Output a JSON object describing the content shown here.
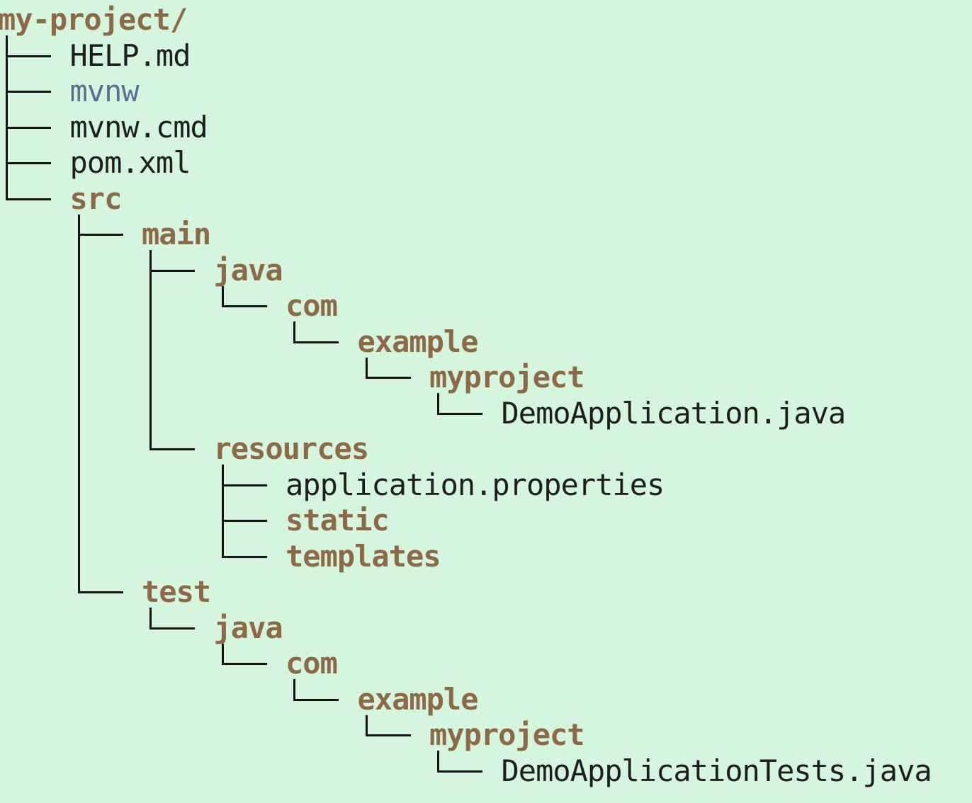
{
  "tree": {
    "root": "my-project/",
    "nodes": [
      {
        "id": "help-md",
        "label": "HELP.md",
        "kind": "file",
        "depth": 1,
        "last": false,
        "row": 1
      },
      {
        "id": "mvnw",
        "label": "mvnw",
        "kind": "exec",
        "depth": 1,
        "last": false,
        "row": 2
      },
      {
        "id": "mvnw-cmd",
        "label": "mvnw.cmd",
        "kind": "file",
        "depth": 1,
        "last": false,
        "row": 3
      },
      {
        "id": "pom-xml",
        "label": "pom.xml",
        "kind": "file",
        "depth": 1,
        "last": false,
        "row": 4
      },
      {
        "id": "src",
        "label": "src",
        "kind": "dir",
        "depth": 1,
        "last": true,
        "row": 5
      },
      {
        "id": "src-main",
        "label": "main",
        "kind": "dir",
        "depth": 2,
        "last": false,
        "row": 6
      },
      {
        "id": "main-java",
        "label": "java",
        "kind": "dir",
        "depth": 3,
        "last": false,
        "row": 7
      },
      {
        "id": "main-com",
        "label": "com",
        "kind": "dir",
        "depth": 4,
        "last": true,
        "row": 8
      },
      {
        "id": "main-example",
        "label": "example",
        "kind": "dir",
        "depth": 5,
        "last": true,
        "row": 9
      },
      {
        "id": "main-myproject",
        "label": "myproject",
        "kind": "dir",
        "depth": 6,
        "last": true,
        "row": 10
      },
      {
        "id": "demo-application-java",
        "label": "DemoApplication.java",
        "kind": "file",
        "depth": 7,
        "last": true,
        "row": 11
      },
      {
        "id": "main-resources",
        "label": "resources",
        "kind": "dir",
        "depth": 3,
        "last": true,
        "row": 12
      },
      {
        "id": "application-properties",
        "label": "application.properties",
        "kind": "file",
        "depth": 4,
        "last": false,
        "row": 13
      },
      {
        "id": "static",
        "label": "static",
        "kind": "dir",
        "depth": 4,
        "last": false,
        "row": 14
      },
      {
        "id": "templates",
        "label": "templates",
        "kind": "dir",
        "depth": 4,
        "last": false,
        "row": 15
      },
      {
        "id": "src-test",
        "label": "test",
        "kind": "dir",
        "depth": 2,
        "last": true,
        "row": 16
      },
      {
        "id": "test-java",
        "label": "java",
        "kind": "dir",
        "depth": 3,
        "last": true,
        "row": 17
      },
      {
        "id": "test-com",
        "label": "com",
        "kind": "dir",
        "depth": 4,
        "last": true,
        "row": 18
      },
      {
        "id": "test-example",
        "label": "example",
        "kind": "dir",
        "depth": 5,
        "last": true,
        "row": 19
      },
      {
        "id": "test-myproject",
        "label": "myproject",
        "kind": "dir",
        "depth": 6,
        "last": true,
        "row": 20
      },
      {
        "id": "demo-application-tests-java",
        "label": "DemoApplicationTests.java",
        "kind": "file",
        "depth": 7,
        "last": true,
        "row": 21
      }
    ]
  }
}
